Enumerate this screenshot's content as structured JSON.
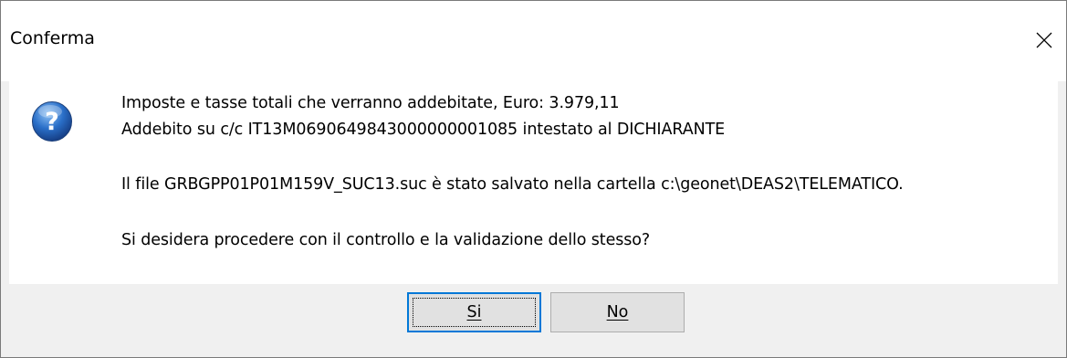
{
  "dialog": {
    "title": "Conferma",
    "close_icon": "close-icon",
    "message_icon": "question-icon",
    "messages": {
      "line1": "Imposte e tasse totali che verranno addebitate, Euro: 3.979,11",
      "line2": "Addebito su c/c IT13M0690649843000000001085 intestato al DICHIARANTE",
      "line3": "Il file GRBGPP01P01M159V_SUC13.suc è stato salvato nella cartella c:\\geonet\\DEAS2\\TELEMATICO.",
      "line4": "Si desidera procedere con il controllo e la validazione dello stesso?"
    },
    "buttons": {
      "yes_label": "Si",
      "no_label": "No"
    }
  },
  "colors": {
    "icon_blue": "#2a6fc8",
    "footer_bg": "#f0f0f0",
    "default_button_border": "#0078d7"
  }
}
